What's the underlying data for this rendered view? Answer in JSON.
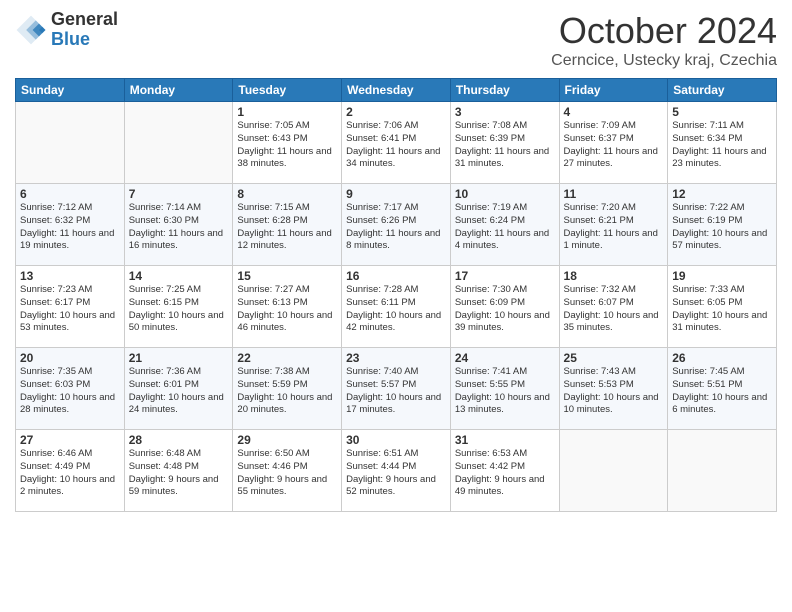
{
  "logo": {
    "general": "General",
    "blue": "Blue"
  },
  "title": "October 2024",
  "subtitle": "Cerncice, Ustecky kraj, Czechia",
  "days_of_week": [
    "Sunday",
    "Monday",
    "Tuesday",
    "Wednesday",
    "Thursday",
    "Friday",
    "Saturday"
  ],
  "weeks": [
    [
      {
        "day": "",
        "content": ""
      },
      {
        "day": "",
        "content": ""
      },
      {
        "day": "1",
        "content": "Sunrise: 7:05 AM\nSunset: 6:43 PM\nDaylight: 11 hours and 38 minutes."
      },
      {
        "day": "2",
        "content": "Sunrise: 7:06 AM\nSunset: 6:41 PM\nDaylight: 11 hours and 34 minutes."
      },
      {
        "day": "3",
        "content": "Sunrise: 7:08 AM\nSunset: 6:39 PM\nDaylight: 11 hours and 31 minutes."
      },
      {
        "day": "4",
        "content": "Sunrise: 7:09 AM\nSunset: 6:37 PM\nDaylight: 11 hours and 27 minutes."
      },
      {
        "day": "5",
        "content": "Sunrise: 7:11 AM\nSunset: 6:34 PM\nDaylight: 11 hours and 23 minutes."
      }
    ],
    [
      {
        "day": "6",
        "content": "Sunrise: 7:12 AM\nSunset: 6:32 PM\nDaylight: 11 hours and 19 minutes."
      },
      {
        "day": "7",
        "content": "Sunrise: 7:14 AM\nSunset: 6:30 PM\nDaylight: 11 hours and 16 minutes."
      },
      {
        "day": "8",
        "content": "Sunrise: 7:15 AM\nSunset: 6:28 PM\nDaylight: 11 hours and 12 minutes."
      },
      {
        "day": "9",
        "content": "Sunrise: 7:17 AM\nSunset: 6:26 PM\nDaylight: 11 hours and 8 minutes."
      },
      {
        "day": "10",
        "content": "Sunrise: 7:19 AM\nSunset: 6:24 PM\nDaylight: 11 hours and 4 minutes."
      },
      {
        "day": "11",
        "content": "Sunrise: 7:20 AM\nSunset: 6:21 PM\nDaylight: 11 hours and 1 minute."
      },
      {
        "day": "12",
        "content": "Sunrise: 7:22 AM\nSunset: 6:19 PM\nDaylight: 10 hours and 57 minutes."
      }
    ],
    [
      {
        "day": "13",
        "content": "Sunrise: 7:23 AM\nSunset: 6:17 PM\nDaylight: 10 hours and 53 minutes."
      },
      {
        "day": "14",
        "content": "Sunrise: 7:25 AM\nSunset: 6:15 PM\nDaylight: 10 hours and 50 minutes."
      },
      {
        "day": "15",
        "content": "Sunrise: 7:27 AM\nSunset: 6:13 PM\nDaylight: 10 hours and 46 minutes."
      },
      {
        "day": "16",
        "content": "Sunrise: 7:28 AM\nSunset: 6:11 PM\nDaylight: 10 hours and 42 minutes."
      },
      {
        "day": "17",
        "content": "Sunrise: 7:30 AM\nSunset: 6:09 PM\nDaylight: 10 hours and 39 minutes."
      },
      {
        "day": "18",
        "content": "Sunrise: 7:32 AM\nSunset: 6:07 PM\nDaylight: 10 hours and 35 minutes."
      },
      {
        "day": "19",
        "content": "Sunrise: 7:33 AM\nSunset: 6:05 PM\nDaylight: 10 hours and 31 minutes."
      }
    ],
    [
      {
        "day": "20",
        "content": "Sunrise: 7:35 AM\nSunset: 6:03 PM\nDaylight: 10 hours and 28 minutes."
      },
      {
        "day": "21",
        "content": "Sunrise: 7:36 AM\nSunset: 6:01 PM\nDaylight: 10 hours and 24 minutes."
      },
      {
        "day": "22",
        "content": "Sunrise: 7:38 AM\nSunset: 5:59 PM\nDaylight: 10 hours and 20 minutes."
      },
      {
        "day": "23",
        "content": "Sunrise: 7:40 AM\nSunset: 5:57 PM\nDaylight: 10 hours and 17 minutes."
      },
      {
        "day": "24",
        "content": "Sunrise: 7:41 AM\nSunset: 5:55 PM\nDaylight: 10 hours and 13 minutes."
      },
      {
        "day": "25",
        "content": "Sunrise: 7:43 AM\nSunset: 5:53 PM\nDaylight: 10 hours and 10 minutes."
      },
      {
        "day": "26",
        "content": "Sunrise: 7:45 AM\nSunset: 5:51 PM\nDaylight: 10 hours and 6 minutes."
      }
    ],
    [
      {
        "day": "27",
        "content": "Sunrise: 6:46 AM\nSunset: 4:49 PM\nDaylight: 10 hours and 2 minutes."
      },
      {
        "day": "28",
        "content": "Sunrise: 6:48 AM\nSunset: 4:48 PM\nDaylight: 9 hours and 59 minutes."
      },
      {
        "day": "29",
        "content": "Sunrise: 6:50 AM\nSunset: 4:46 PM\nDaylight: 9 hours and 55 minutes."
      },
      {
        "day": "30",
        "content": "Sunrise: 6:51 AM\nSunset: 4:44 PM\nDaylight: 9 hours and 52 minutes."
      },
      {
        "day": "31",
        "content": "Sunrise: 6:53 AM\nSunset: 4:42 PM\nDaylight: 9 hours and 49 minutes."
      },
      {
        "day": "",
        "content": ""
      },
      {
        "day": "",
        "content": ""
      }
    ]
  ]
}
